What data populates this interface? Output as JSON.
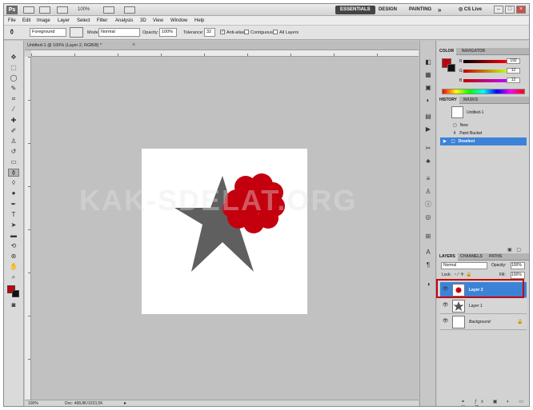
{
  "app": {
    "logo": "Ps"
  },
  "titlebar": {
    "zoom": "100%",
    "workspaces": [
      "ESSENTIALS",
      "DESIGN",
      "PAINTING"
    ],
    "more": "»",
    "cslive": "CS Live",
    "win_min": "–",
    "win_max": "□",
    "win_close": "×"
  },
  "menu": [
    "File",
    "Edit",
    "Image",
    "Layer",
    "Select",
    "Filter",
    "Analysis",
    "3D",
    "View",
    "Window",
    "Help"
  ],
  "options": {
    "fill_source": "Foreground",
    "mode_label": "Mode:",
    "mode_value": "Normal",
    "opacity_label": "Opacity:",
    "opacity_value": "100%",
    "tolerance_label": "Tolerance:",
    "tolerance_value": "32",
    "anti_alias": "Anti-alias",
    "contiguous": "Contiguous",
    "all_layers": "All Layers",
    "anti_alias_checked": true
  },
  "document": {
    "tab_title": "Untitled-1 @ 100% (Layer 2, RGB/8) *",
    "close": "×",
    "status_zoom": "100%",
    "status_doc": "Doc: 468,8K/1023,5K",
    "watermark": "KAK-SDELAT.ORG",
    "colors": {
      "star": "#5f5f5f",
      "flower": "#c4000e"
    }
  },
  "panels": {
    "color": {
      "tabs": [
        "COLOR",
        "NAVIGATOR"
      ],
      "r_label": "R",
      "g_label": "G",
      "b_label": "B",
      "r": "192",
      "g": "12",
      "b": "12",
      "foreground": "#c0000c",
      "background": "#111111"
    },
    "history": {
      "tabs": [
        "HISTORY",
        "MASKS"
      ],
      "snapshot": "Untitled-1",
      "items": [
        "New",
        "Paint Bucket",
        "Deselect"
      ],
      "selected": "Deselect"
    },
    "layers": {
      "tabs": [
        "LAYERS",
        "CHANNELS",
        "PATHS"
      ],
      "blend_mode": "Normal",
      "opacity_label": "Opacity:",
      "opacity": "100%",
      "lock_label": "Lock:",
      "fill_label": "Fill:",
      "fill": "100%",
      "items": [
        {
          "name": "Layer 2",
          "selected": true
        },
        {
          "name": "Layer 1",
          "selected": false
        },
        {
          "name": "Background",
          "selected": false
        }
      ]
    }
  }
}
